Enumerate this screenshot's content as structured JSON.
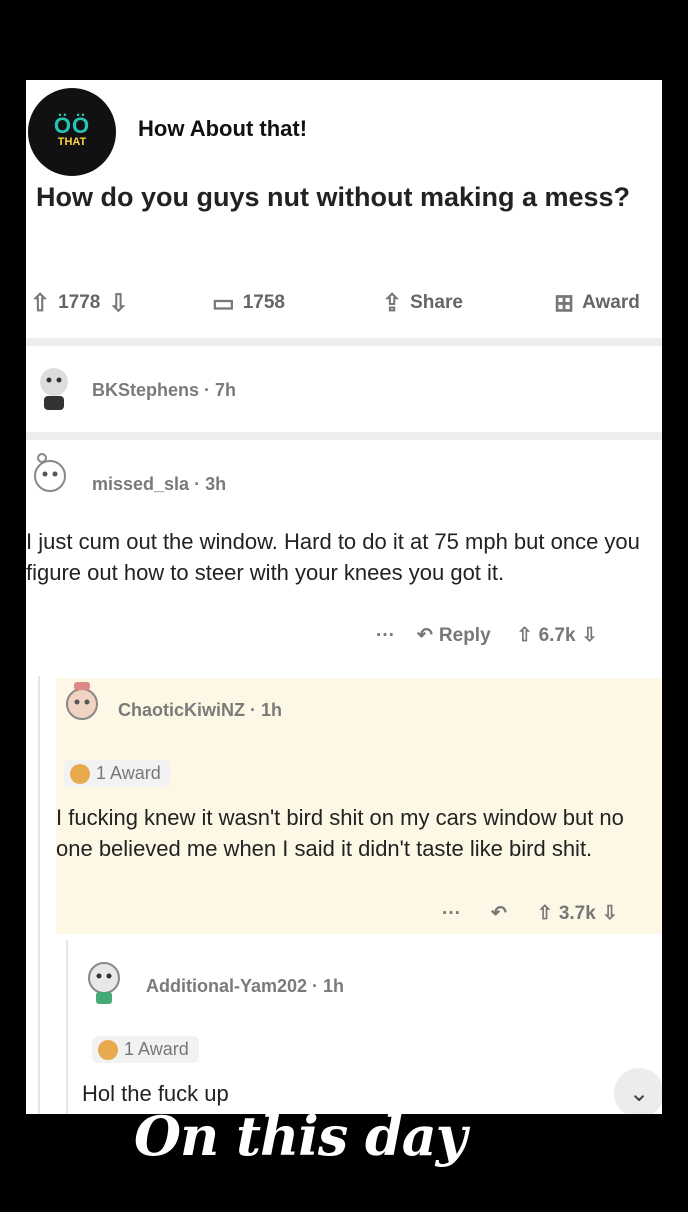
{
  "post": {
    "channel_logo_glyph": "ÖÖ",
    "channel_logo_text": "THAT",
    "channel_name": "How About that!",
    "title": "How do you guys nut without making a mess?",
    "upvotes": "1778",
    "comments": "1758",
    "share_label": "Share",
    "award_label": "Award"
  },
  "comments": [
    {
      "author": "BKStephens",
      "time": "7h"
    },
    {
      "author": "missed_sla",
      "time": "3h",
      "body": "I just cum out the window. Hard to do it at 75 mph but once you figure out how to steer with your knees you got it.",
      "more": "···",
      "reply_label": "Reply",
      "score": "6.7k"
    },
    {
      "author": "ChaoticKiwiNZ",
      "time": "1h",
      "award": "1 Award",
      "body": "I fucking knew it wasn't bird shit on my cars window but no one believed me when I said it didn't taste like bird shit.",
      "more": "···",
      "score": "3.7k"
    },
    {
      "author": "Additional-Yam202",
      "time": "1h",
      "award": "1 Award",
      "body": "Hol the fuck up"
    }
  ],
  "caption": "On this day",
  "icons": {
    "upvote": "upvote-arrow-icon",
    "downvote": "downvote-arrow-icon",
    "comment": "comment-bubble-icon",
    "share": "share-icon",
    "award": "gift-award-icon",
    "reply": "reply-arrow-icon",
    "collapse": "chevron-down-icon"
  },
  "colors": {
    "highlight": "#fdf8e5",
    "logo_accent": "#29c3b6",
    "award_coin": "#e9a94f"
  }
}
